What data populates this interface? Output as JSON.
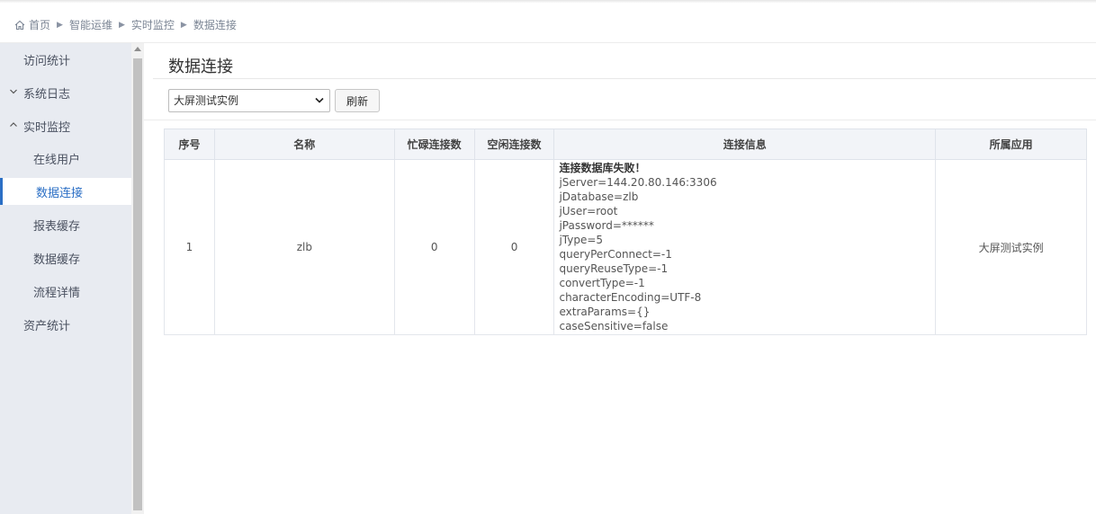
{
  "breadcrumb": {
    "items": [
      "首页",
      "智能运维",
      "实时监控",
      "数据连接"
    ]
  },
  "sidebar": {
    "items": [
      {
        "label": "访问统计"
      },
      {
        "label": "系统日志"
      },
      {
        "label": "实时监控"
      },
      {
        "label": "在线用户"
      },
      {
        "label": "数据连接"
      },
      {
        "label": "报表缓存"
      },
      {
        "label": "数据缓存"
      },
      {
        "label": "流程详情"
      },
      {
        "label": "资产统计"
      }
    ],
    "active_index": 4
  },
  "main": {
    "title": "数据连接",
    "select_value": "大屏测试实例",
    "refresh_label": "刷新"
  },
  "table": {
    "headers": [
      "序号",
      "名称",
      "忙碌连接数",
      "空闲连接数",
      "连接信息",
      "所属应用"
    ],
    "rows": [
      {
        "index": "1",
        "name": "zlb",
        "busy": "0",
        "idle": "0",
        "info_error": "连接数据库失败！",
        "info_lines": [
          "jServer=144.20.80.146:3306",
          "jDatabase=zlb",
          "jUser=root",
          "jPassword=******",
          "jType=5",
          "queryPerConnect=-1",
          "queryReuseType=-1",
          "convertType=-1",
          "characterEncoding=UTF-8",
          "extraParams={}",
          "caseSensitive=false"
        ],
        "app": "大屏测试实例"
      }
    ]
  },
  "colors": {
    "accent": "#2b6fc5",
    "sidebar_bg": "#e8ebf1",
    "header_bg": "#f2f4f8"
  }
}
